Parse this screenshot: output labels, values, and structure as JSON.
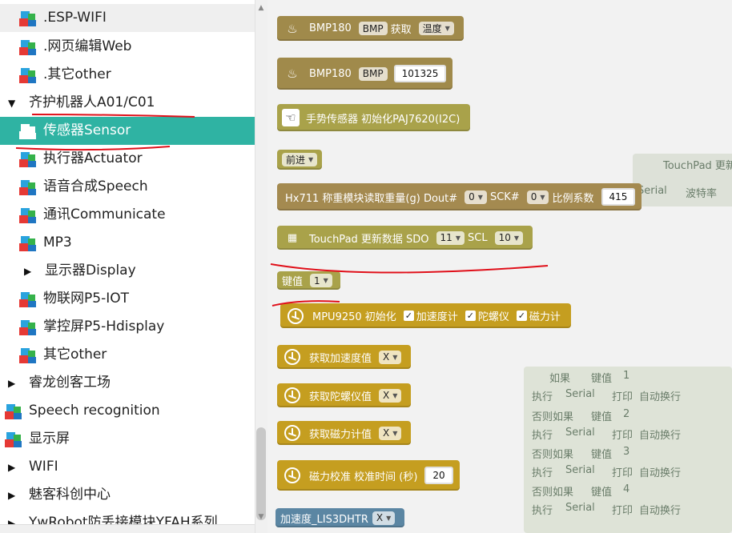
{
  "sidebar": {
    "items": [
      {
        "label": ".ESP-WIFI",
        "icon": "blocks-icon"
      },
      {
        "label": ".网页编辑Web",
        "icon": "blocks-icon"
      },
      {
        "label": ".其它other",
        "icon": "blocks-icon"
      },
      {
        "label": "齐护机器人A01/C01",
        "arrow": "▼"
      },
      {
        "label": "传感器Sensor",
        "icon": "blocks-icon",
        "active": true
      },
      {
        "label": "执行器Actuator",
        "icon": "blocks-icon"
      },
      {
        "label": "语音合成Speech",
        "icon": "blocks-icon"
      },
      {
        "label": "通讯Communicate",
        "icon": "blocks-icon"
      },
      {
        "label": "MP3",
        "icon": "blocks-icon"
      },
      {
        "label": "显示器Display",
        "arrow": "▶"
      },
      {
        "label": "物联网P5-IOT",
        "icon": "blocks-icon"
      },
      {
        "label": "掌控屏P5-Hdisplay",
        "icon": "blocks-icon"
      },
      {
        "label": "其它other",
        "icon": "blocks-icon"
      },
      {
        "label": "睿龙创客工场",
        "arrow": "▶"
      },
      {
        "label": "Speech recognition",
        "icon": "blocks-icon"
      },
      {
        "label": "显示屏",
        "icon": "blocks-icon"
      },
      {
        "label": "WIFI",
        "arrow": "▶"
      },
      {
        "label": "魅客科创中心",
        "arrow": "▶"
      },
      {
        "label": "YwRobot防丢接模块YFAH系列",
        "arrow": "▶"
      }
    ]
  },
  "blocks": {
    "bmp_get": {
      "t1": "BMP180",
      "dd1": "BMP",
      "t2": "获取",
      "dd2": "温度"
    },
    "bmp_pressure": {
      "t1": "BMP180",
      "dd1": "BMP",
      "value": "101325"
    },
    "gesture": {
      "text": "手势传感器 初始化PAJ7620(I2C)"
    },
    "direction": {
      "dd": "前进"
    },
    "hx711": {
      "t1": "Hx711  称重模块读取重量(g)  Dout#",
      "dd1": "0",
      "t2": "SCK#",
      "dd2": "0",
      "t3": "比例系数",
      "value": "415"
    },
    "touchpad": {
      "t1": "TouchPad 更新数据  SDO",
      "dd1": "11",
      "t2": "SCL",
      "dd2": "10"
    },
    "keyval": {
      "t1": "键值",
      "dd": "1"
    },
    "mpu_init": {
      "t1": "MPU9250 初始化",
      "c1": "加速度计",
      "c2": "陀螺仪",
      "c3": "磁力计"
    },
    "get_acc": {
      "t1": "获取加速度值",
      "dd": "X"
    },
    "get_gyro": {
      "t1": "获取陀螺仪值",
      "dd": "X"
    },
    "get_mag": {
      "t1": "获取磁力计值",
      "dd": "X"
    },
    "mag_cal": {
      "t1": "磁力校准  校准时间 (秒)",
      "value": "20"
    },
    "lis3dh": {
      "t1": "加速度_LIS3DHTR",
      "dd": "X"
    }
  },
  "ghost": {
    "touchpad_label": "TouchPad 更新",
    "serial_label": "Serial",
    "baud_label": "波特率",
    "if_label": "如果",
    "do_label": "执行",
    "elseif_label": "否则如果",
    "key_label": "键值",
    "print_label": "打印",
    "newline_label": "自动换行",
    "keys": [
      "1",
      "2",
      "3",
      "4"
    ]
  },
  "colors": {
    "active_row": "#2fb3a3",
    "bmp": "#a08a4b",
    "olive": "#a9a24a",
    "mpu": "#c59e20",
    "accent_blue": "#5b86a3",
    "pen_red": "#e0101a"
  }
}
